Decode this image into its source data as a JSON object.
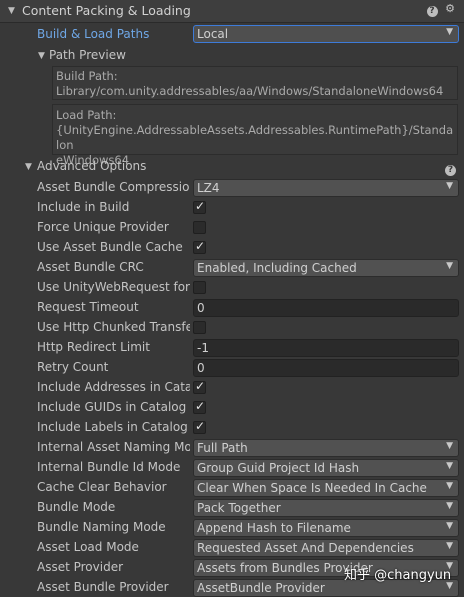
{
  "header": {
    "title": "Content Packing & Loading"
  },
  "build_load_paths": {
    "label": "Build & Load Paths",
    "value": "Local"
  },
  "path_preview": {
    "label": "Path Preview",
    "build_path": [
      "Build Path:",
      "Library/com.unity.addressables/aa/Windows/StandaloneWindows64"
    ],
    "load_path": [
      "Load Path:",
      "{UnityEngine.AddressableAssets.Addressables.RuntimePath}/Standalon",
      "eWindows64"
    ]
  },
  "advanced": {
    "label": "Advanced Options",
    "fields": [
      {
        "label": "Asset Bundle Compression",
        "type": "dropdown",
        "value": "LZ4"
      },
      {
        "label": "Include in Build",
        "type": "checkbox",
        "checked": true
      },
      {
        "label": "Force Unique Provider",
        "type": "checkbox",
        "checked": false
      },
      {
        "label": "Use Asset Bundle Cache",
        "type": "checkbox",
        "checked": true
      },
      {
        "label": "Asset Bundle CRC",
        "type": "dropdown",
        "value": "Enabled, Including Cached"
      },
      {
        "label": "Use UnityWebRequest for L",
        "type": "checkbox",
        "checked": false
      },
      {
        "label": "Request Timeout",
        "type": "text",
        "value": "0"
      },
      {
        "label": "Use Http Chunked Transfer",
        "type": "checkbox",
        "checked": false
      },
      {
        "label": "Http Redirect Limit",
        "type": "text",
        "value": "-1"
      },
      {
        "label": "Retry Count",
        "type": "text",
        "value": "0"
      },
      {
        "label": "Include Addresses in Catalo",
        "type": "checkbox",
        "checked": true
      },
      {
        "label": "Include GUIDs in Catalog",
        "type": "checkbox",
        "checked": true
      },
      {
        "label": "Include Labels in Catalog",
        "type": "checkbox",
        "checked": true
      },
      {
        "label": "Internal Asset Naming Mode",
        "type": "dropdown",
        "value": "Full Path"
      },
      {
        "label": "Internal Bundle Id Mode",
        "type": "dropdown",
        "value": "Group Guid Project Id Hash"
      },
      {
        "label": "Cache Clear Behavior",
        "type": "dropdown",
        "value": "Clear When Space Is Needed In Cache"
      },
      {
        "label": "Bundle Mode",
        "type": "dropdown",
        "value": "Pack Together"
      },
      {
        "label": "Bundle Naming Mode",
        "type": "dropdown",
        "value": "Append Hash to Filename"
      },
      {
        "label": "Asset Load Mode",
        "type": "dropdown",
        "value": "Requested Asset And Dependencies"
      },
      {
        "label": "Asset Provider",
        "type": "dropdown",
        "value": "Assets from Bundles Provider"
      },
      {
        "label": "Asset Bundle Provider",
        "type": "dropdown",
        "value": "AssetBundle Provider"
      }
    ]
  },
  "icons": {
    "help": "question-icon",
    "settings": "gear-icon",
    "caret": "dropdown-caret-icon",
    "check": "checkmark-icon"
  },
  "watermark": "知乎 @changyun"
}
